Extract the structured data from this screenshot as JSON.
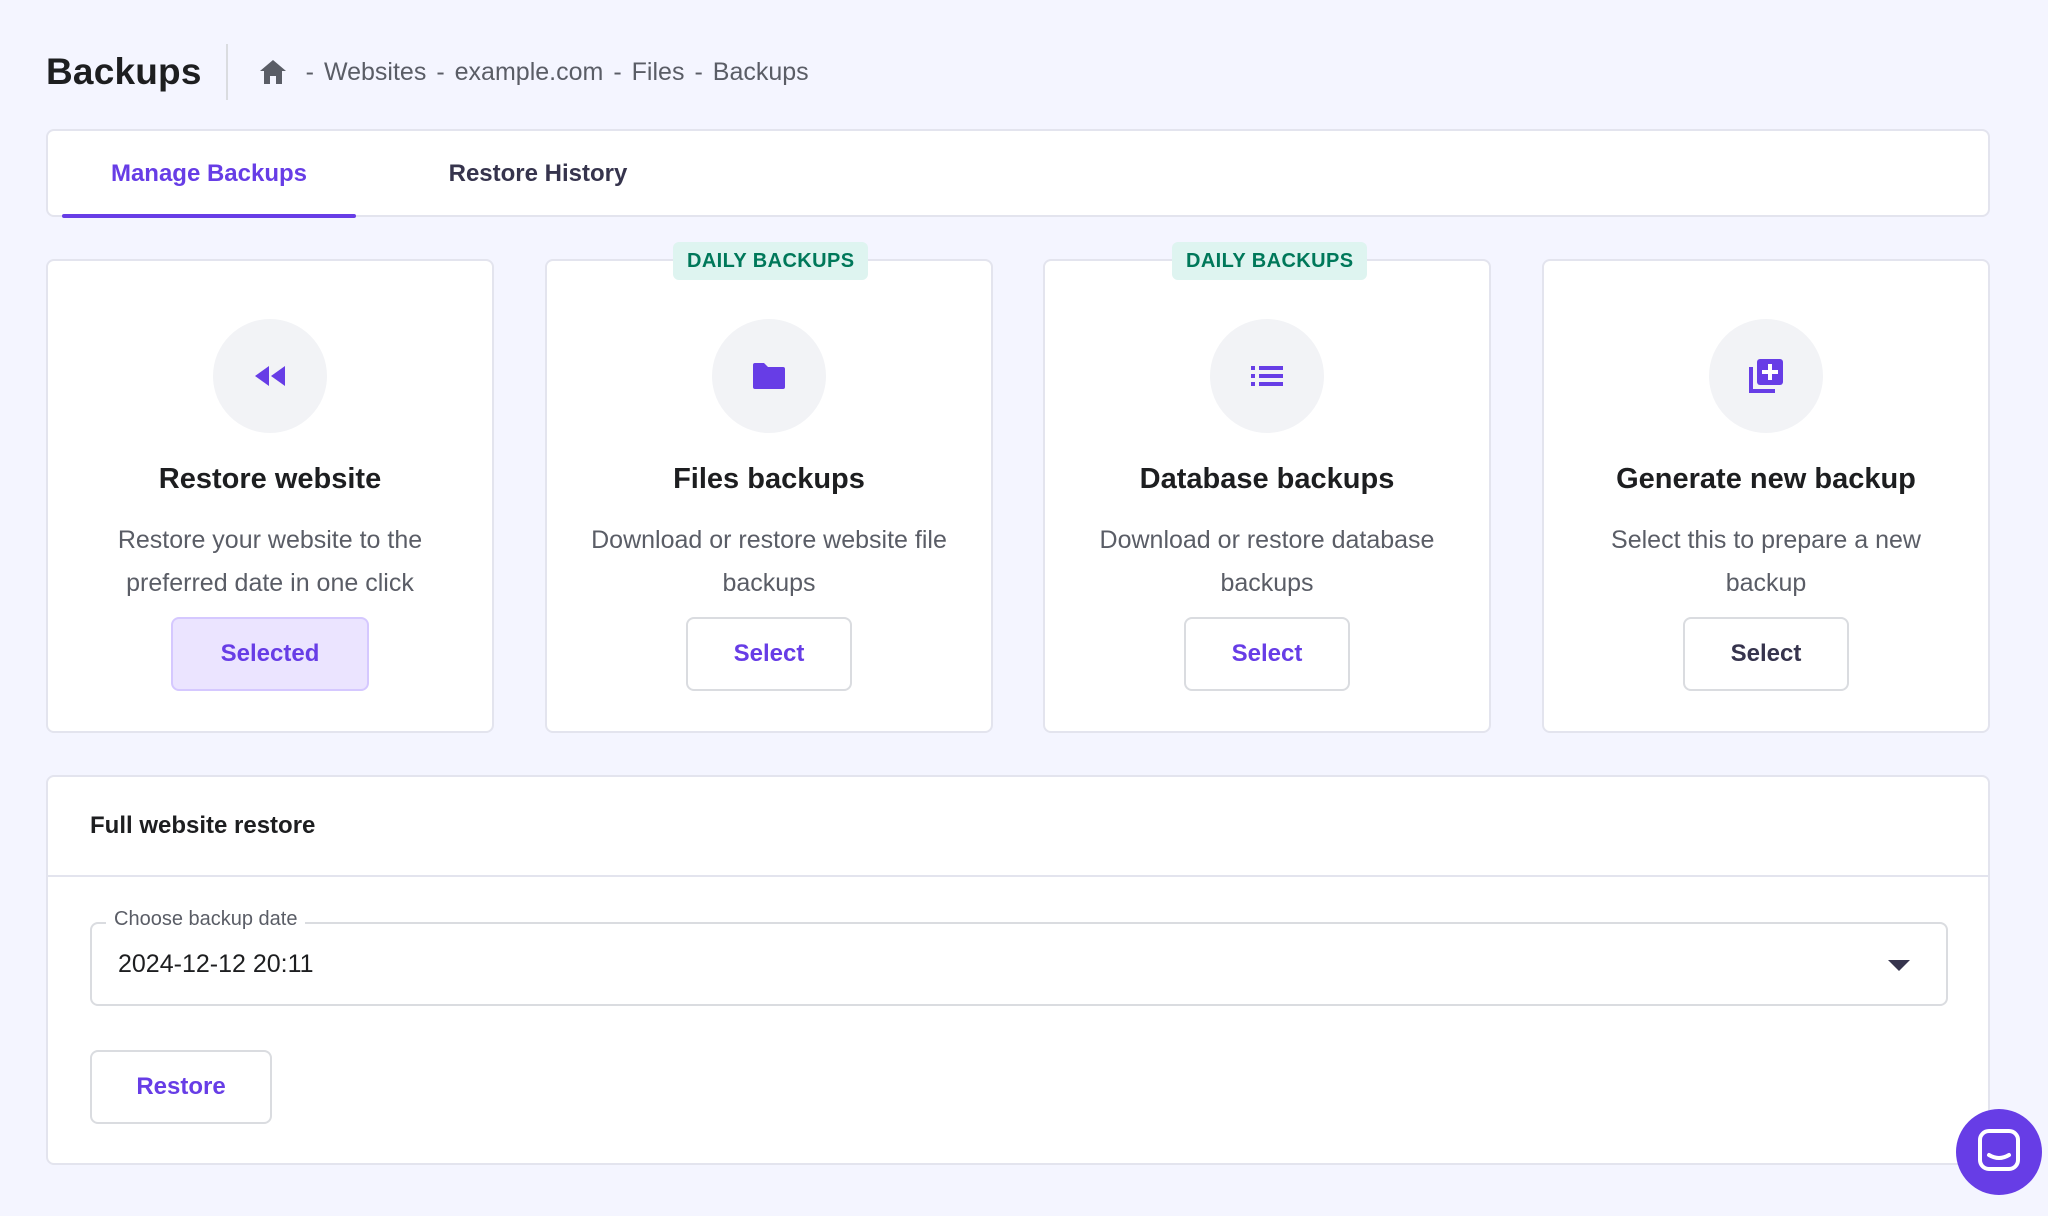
{
  "header": {
    "title": "Backups",
    "breadcrumb": {
      "home_icon": "home-icon",
      "separator": "-",
      "items": [
        "Websites",
        "example.com",
        "Files",
        "Backups"
      ]
    }
  },
  "tabs": [
    {
      "label": "Manage Backups",
      "active": true
    },
    {
      "label": "Restore History",
      "active": false
    }
  ],
  "options": [
    {
      "icon": "rewind-icon",
      "title": "Restore website",
      "description": "Restore your website to the preferred date in one click",
      "button": "Selected",
      "badge": ""
    },
    {
      "icon": "folder-icon",
      "title": "Files backups",
      "description": "Download or restore website file backups",
      "button": "Select",
      "badge": "DAILY BACKUPS"
    },
    {
      "icon": "list-icon",
      "title": "Database backups",
      "description": "Download or restore database backups",
      "button": "Select",
      "badge": "DAILY BACKUPS"
    },
    {
      "icon": "add-box-icon",
      "title": "Generate new backup",
      "description": "Select this to prepare a new backup",
      "button": "Select",
      "badge": ""
    }
  ],
  "full_restore": {
    "title": "Full website restore",
    "date_label": "Choose backup date",
    "date_value": "2024-12-12 20:11",
    "restore_button": "Restore"
  },
  "chat": {
    "icon": "chat-icon"
  },
  "colors": {
    "accent": "#673de6",
    "background": "#f4f5ff",
    "badge_bg": "#def4f0",
    "badge_text": "#00785a",
    "selected_bg": "#ebe4ff"
  }
}
